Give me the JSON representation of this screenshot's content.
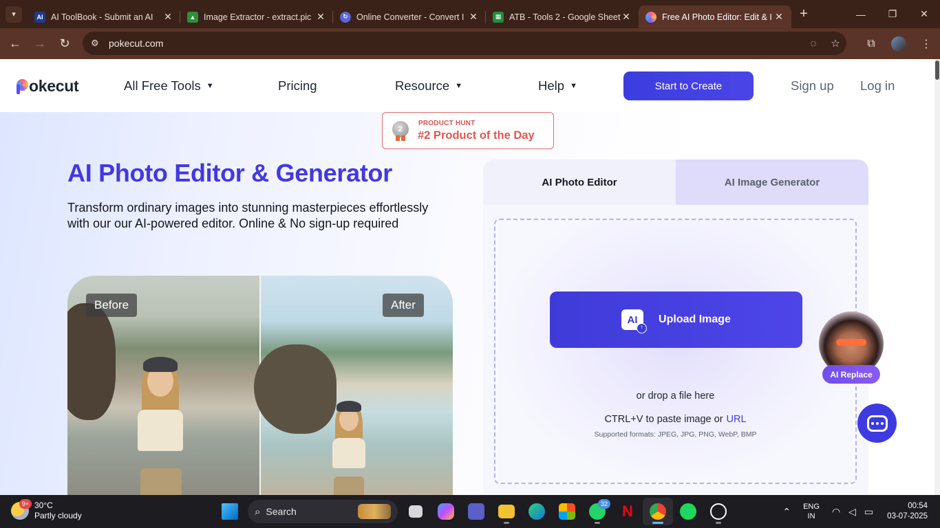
{
  "browser": {
    "tabs": [
      {
        "title": "AI ToolBook - Submit an AI",
        "favicon": "ai-toolbook-icon",
        "color": "#1f3b8f",
        "letter": "AI"
      },
      {
        "title": "Image Extractor - extract.pic",
        "favicon": "image-icon",
        "color": "#2f8f3a",
        "letter": ""
      },
      {
        "title": "Online Converter - Convert I",
        "favicon": "converter-icon",
        "color": "#5a63d6",
        "letter": ""
      },
      {
        "title": "ATB - Tools 2 - Google Sheet",
        "favicon": "sheets-icon",
        "color": "#1e8e3e",
        "letter": ""
      },
      {
        "title": "Free AI Photo Editor: Edit & I",
        "favicon": "pokecut-icon",
        "color": "#d95b8f",
        "letter": ""
      }
    ],
    "url": "pokecut.com"
  },
  "nav": {
    "logo": "okecut",
    "all_tools": "All Free Tools",
    "pricing": "Pricing",
    "resource": "Resource",
    "help": "Help",
    "cta": "Start to Create",
    "signup": "Sign up",
    "login": "Log in"
  },
  "badge": {
    "medal": "2",
    "kicker": "PRODUCT HUNT",
    "text": "#2 Product of the Day"
  },
  "hero": {
    "title": "AI Photo Editor & Generator",
    "subtitle": "Transform ordinary images into stunning masterpieces effortlessly with our our AI-powered editor. Online & No sign-up required",
    "before_label": "Before",
    "after_label": "After"
  },
  "panel": {
    "tab_editor": "AI Photo Editor",
    "tab_generator": "AI Image Generator",
    "upload_icon_text": "AI",
    "upload_label": "Upload Image",
    "drop_text": "or drop a file here",
    "paste_text": "CTRL+V to paste image or",
    "url_link": "URL",
    "formats": "Supported formats: JPEG, JPG, PNG, WebP, BMP"
  },
  "floating": {
    "ai_replace": "AI Replace"
  },
  "taskbar": {
    "weather_badge": "9+",
    "temperature": "30°C",
    "condition": "Partly cloudy",
    "search": "Search",
    "whatsapp_count": "32",
    "lang_top": "ENG",
    "lang_bottom": "IN",
    "time": "00:54",
    "date": "03-07-2025"
  }
}
